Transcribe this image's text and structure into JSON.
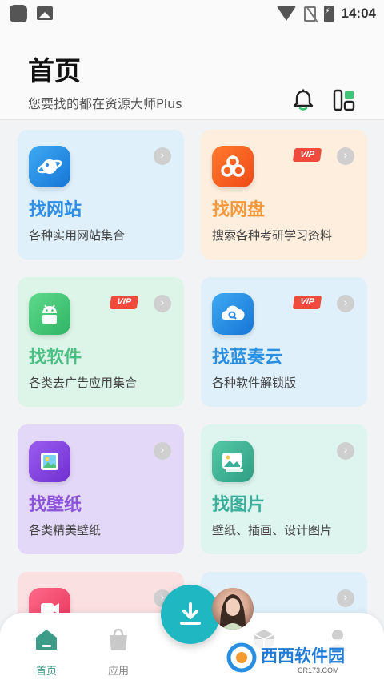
{
  "status_bar": {
    "time": "14:04"
  },
  "header": {
    "title": "首页",
    "subtitle": "您要找的都在资源大师Plus"
  },
  "cards": [
    {
      "title": "找网站",
      "desc": "各种实用网站集合",
      "vip": "",
      "color": "#2f8fe6"
    },
    {
      "title": "找网盘",
      "desc": "搜索各种考研学习资料",
      "vip": "VIP",
      "color": "#f3993d"
    },
    {
      "title": "找软件",
      "desc": "各类去广告应用集合",
      "vip": "VIP",
      "color": "#4bbf83"
    },
    {
      "title": "找蓝奏云",
      "desc": "各种软件解锁版",
      "vip": "VIP",
      "color": "#2a8fe0"
    },
    {
      "title": "找壁纸",
      "desc": "各类精美壁纸",
      "vip": "",
      "color": "#8a53d8"
    },
    {
      "title": "找图片",
      "desc": "壁纸、插画、设计图片",
      "vip": "",
      "color": "#3aae9a"
    }
  ],
  "bottom_nav": {
    "home": "首页",
    "apps": "应用"
  },
  "watermark": {
    "text": "西西软件园",
    "domain": "CR173.COM"
  }
}
